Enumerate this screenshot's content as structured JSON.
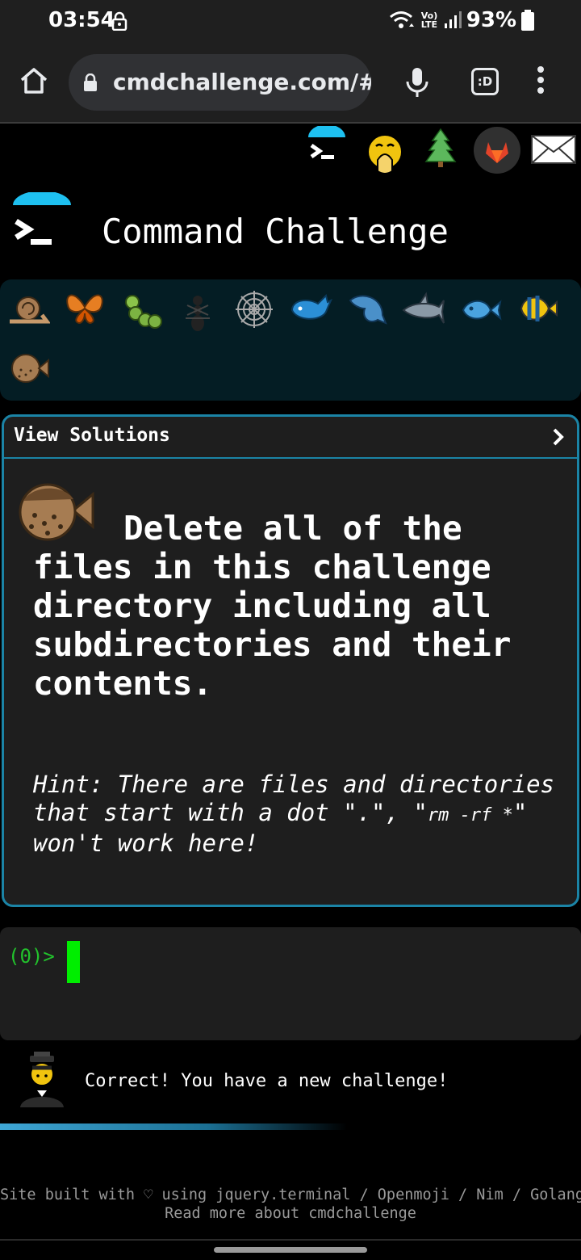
{
  "status_bar": {
    "time": "03:54",
    "battery": "93%",
    "network": "Vo) LTE"
  },
  "browser": {
    "url": "cmdchallenge.com/#/",
    "tabs_label": ":D"
  },
  "header": {
    "title": "Command Challenge",
    "icons": [
      "terminal-icon",
      "face-with-hand-over-mouth-icon",
      "tree-icon",
      "gitlab-icon",
      "mail-icon"
    ]
  },
  "creatures": [
    "snail-icon",
    "butterfly-icon",
    "caterpillar-icon",
    "ant-icon",
    "spider-web-icon",
    "whale-icon",
    "dolphin-icon",
    "shark-icon",
    "fish-icon",
    "tropical-fish-icon",
    "pufferfish-icon"
  ],
  "challenge": {
    "view_solutions": "View Solutions",
    "chevron": "›",
    "description": "Delete all of the files in this challenge directory including all subdirectories and their contents.",
    "hint_prefix": "Hint: There are files and directories that start with a dot \".\", \"",
    "hint_code": "rm -rf *",
    "hint_suffix": "\" won't work here!"
  },
  "terminal": {
    "prompt": "(0)>"
  },
  "status": {
    "message": "Correct! You have a new challenge!"
  },
  "footer": {
    "line1": "Site built with ♡ using jquery.terminal / Openmoji / Nim / Golang",
    "line2": "Read more about cmdchallenge"
  },
  "colors": {
    "accent": "#1b84a6",
    "prompt": "#22c22c",
    "cursor": "#00ee00",
    "panel": "#041d24"
  }
}
